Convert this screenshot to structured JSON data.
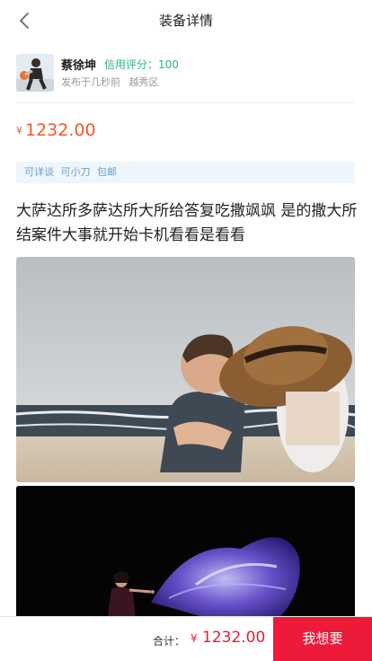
{
  "navbar": {
    "title": "装备详情",
    "back_icon": "chevron-left-icon"
  },
  "seller": {
    "name": "蔡徐坤",
    "credit": "信用评分：100",
    "publish_time": "发布于几秒前",
    "location": "越秀区"
  },
  "price": {
    "symbol": "¥",
    "value": "1232.00"
  },
  "tags": [
    "可详谈",
    "可小刀",
    "包邮"
  ],
  "description": "大萨达所多萨达所大所给答复吃撒飒飒 是的撒大所结案件大事就开始卡机看看是看看",
  "bottom_bar": {
    "total_label": "合计：",
    "total_symbol": "¥",
    "total_value": "1232.00",
    "want_button": "我想要"
  },
  "colors": {
    "price": "#ee5a2c",
    "credit": "#2fb47c",
    "tag_text": "#6f9dc2",
    "tag_background": "#eef6fc",
    "accent": "#ee1a3a"
  }
}
